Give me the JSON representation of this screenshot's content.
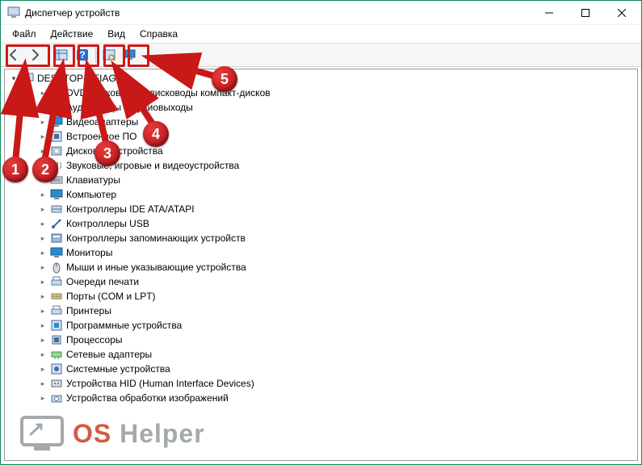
{
  "title": "Диспетчер устройств",
  "menus": {
    "file": "Файл",
    "action": "Действие",
    "view": "Вид",
    "help": "Справка"
  },
  "toolbar": {
    "back": "back-icon",
    "forward": "forward-icon",
    "show_hide": "show-hide-icon",
    "help": "help-icon",
    "scan": "scan-icon",
    "monitor": "monitor-icon"
  },
  "root": {
    "name": "DESKTOP-CFIAGTS"
  },
  "devices": [
    {
      "label": "DVD-дисководы и дисководы компакт-дисков",
      "icon": "dvd"
    },
    {
      "label": "Аудиовходы и аудиовыходы",
      "icon": "audio"
    },
    {
      "label": "Видеоадаптеры",
      "icon": "display"
    },
    {
      "label": "Встроенное ПО",
      "icon": "firmware"
    },
    {
      "label": "Дисковые устройства",
      "icon": "disk"
    },
    {
      "label": "Звуковые, игровые и видеоустройства",
      "icon": "sound"
    },
    {
      "label": "Клавиатуры",
      "icon": "keyboard"
    },
    {
      "label": "Компьютер",
      "icon": "computer"
    },
    {
      "label": "Контроллеры IDE ATA/ATAPI",
      "icon": "ide"
    },
    {
      "label": "Контроллеры USB",
      "icon": "usb"
    },
    {
      "label": "Контроллеры запоминающих устройств",
      "icon": "storage"
    },
    {
      "label": "Мониторы",
      "icon": "monitor"
    },
    {
      "label": "Мыши и иные указывающие устройства",
      "icon": "mouse"
    },
    {
      "label": "Очереди печати",
      "icon": "printqueue"
    },
    {
      "label": "Порты (COM и LPT)",
      "icon": "port"
    },
    {
      "label": "Принтеры",
      "icon": "printer"
    },
    {
      "label": "Программные устройства",
      "icon": "software"
    },
    {
      "label": "Процессоры",
      "icon": "cpu"
    },
    {
      "label": "Сетевые адаптеры",
      "icon": "network"
    },
    {
      "label": "Системные устройства",
      "icon": "system"
    },
    {
      "label": "Устройства HID (Human Interface Devices)",
      "icon": "hid"
    },
    {
      "label": "Устройства обработки изображений",
      "icon": "camera"
    }
  ],
  "watermark": {
    "os": "OS",
    "helper": "Helper"
  },
  "annotations": [
    "1",
    "2",
    "3",
    "4",
    "5"
  ]
}
